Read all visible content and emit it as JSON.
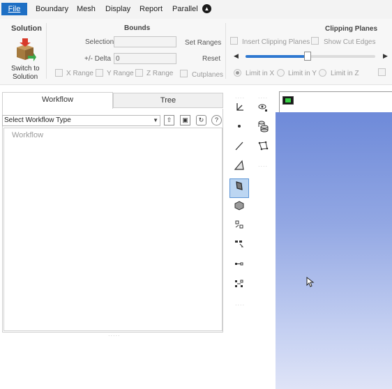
{
  "menu": {
    "file": "File",
    "items": [
      "Boundary",
      "Mesh",
      "Display",
      "Report",
      "Parallel"
    ]
  },
  "ribbon": {
    "solution": {
      "title": "Solution",
      "switch_label_1": "Switch to",
      "switch_label_2": "Solution"
    },
    "bounds": {
      "title": "Bounds",
      "selection_label": "Selection",
      "selection_value": "",
      "delta_label": "+/- Delta",
      "delta_value": "0",
      "set_ranges": "Set Ranges",
      "reset": "Reset",
      "x_range": "X Range",
      "y_range": "Y Range",
      "z_range": "Z Range",
      "cutplanes": "Cutplanes"
    },
    "clipping": {
      "title": "Clipping Planes",
      "insert": "Insert Clipping Planes",
      "show_cut_edges": "Show Cut Edges",
      "slider_level": 0.48,
      "limit_x": "Limit in X",
      "limit_y": "Limit in Y",
      "limit_z": "Limit in Z",
      "selected_limit": "Limit in X"
    }
  },
  "left_panel": {
    "tabs": [
      "Workflow",
      "Tree"
    ],
    "active_tab": "Workflow",
    "workflow_type": "Select Workflow Type",
    "workflow_label": "Workflow"
  },
  "toolbar": {
    "selected_tool": "cell-zone-icon",
    "icons": [
      "axis-icon",
      "point-icon",
      "line-icon",
      "plane-icon",
      "cell-zone-icon",
      "cube-icon",
      "mesh-pick-icon",
      "edge-select-icon",
      "node-link-icon",
      "node-group-icon",
      "visibility-icon",
      "cylinders-icon",
      "polygon-icon"
    ]
  },
  "colors": {
    "file_menu": "#1e6fc4",
    "viewport_top": "#6e8ad9",
    "viewport_bottom": "#dfe4f7",
    "selected_tool": "#bcd6f2"
  }
}
